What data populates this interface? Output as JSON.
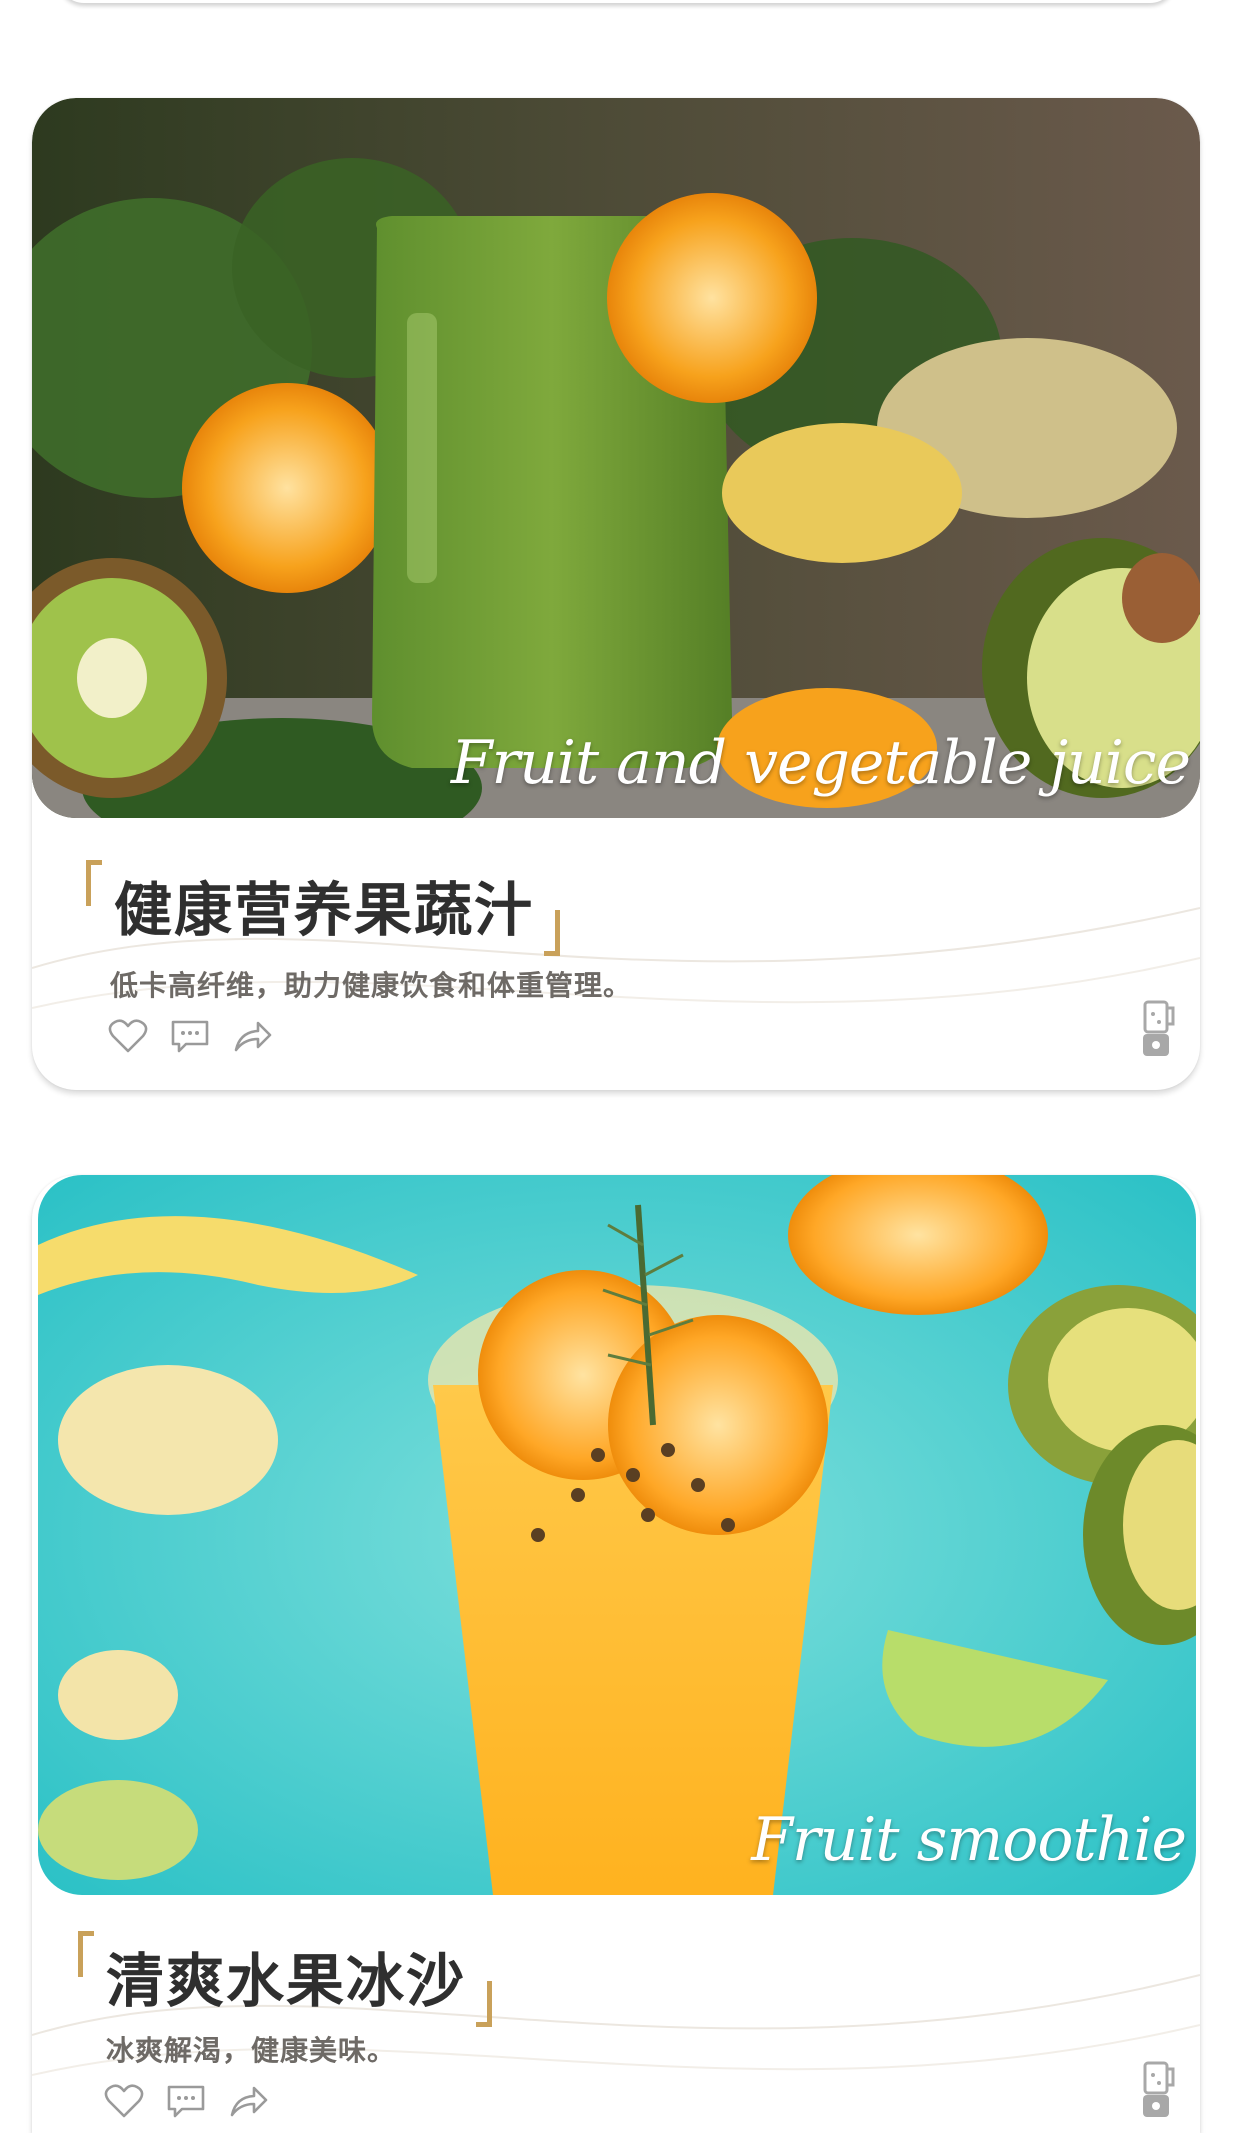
{
  "cards": [
    {
      "script_caption": "Fruit and vegetable juice",
      "title": "健康营养果蔬汁",
      "subtitle": "低卡高纤维，助力健康饮食和体重管理。"
    },
    {
      "script_caption": "Fruit smoothie",
      "title": "清爽水果冰沙",
      "subtitle": "冰爽解渴，健康美味。"
    }
  ],
  "icons": {
    "like": "heart-icon",
    "comment": "comment-icon",
    "share": "share-icon",
    "badge": "blender-icon"
  },
  "colors": {
    "bracket_gold": "#c9a15a",
    "title_text": "#2f2f2f",
    "subtitle_text": "#6e6a66",
    "icon_gray": "#9a9a9a"
  }
}
